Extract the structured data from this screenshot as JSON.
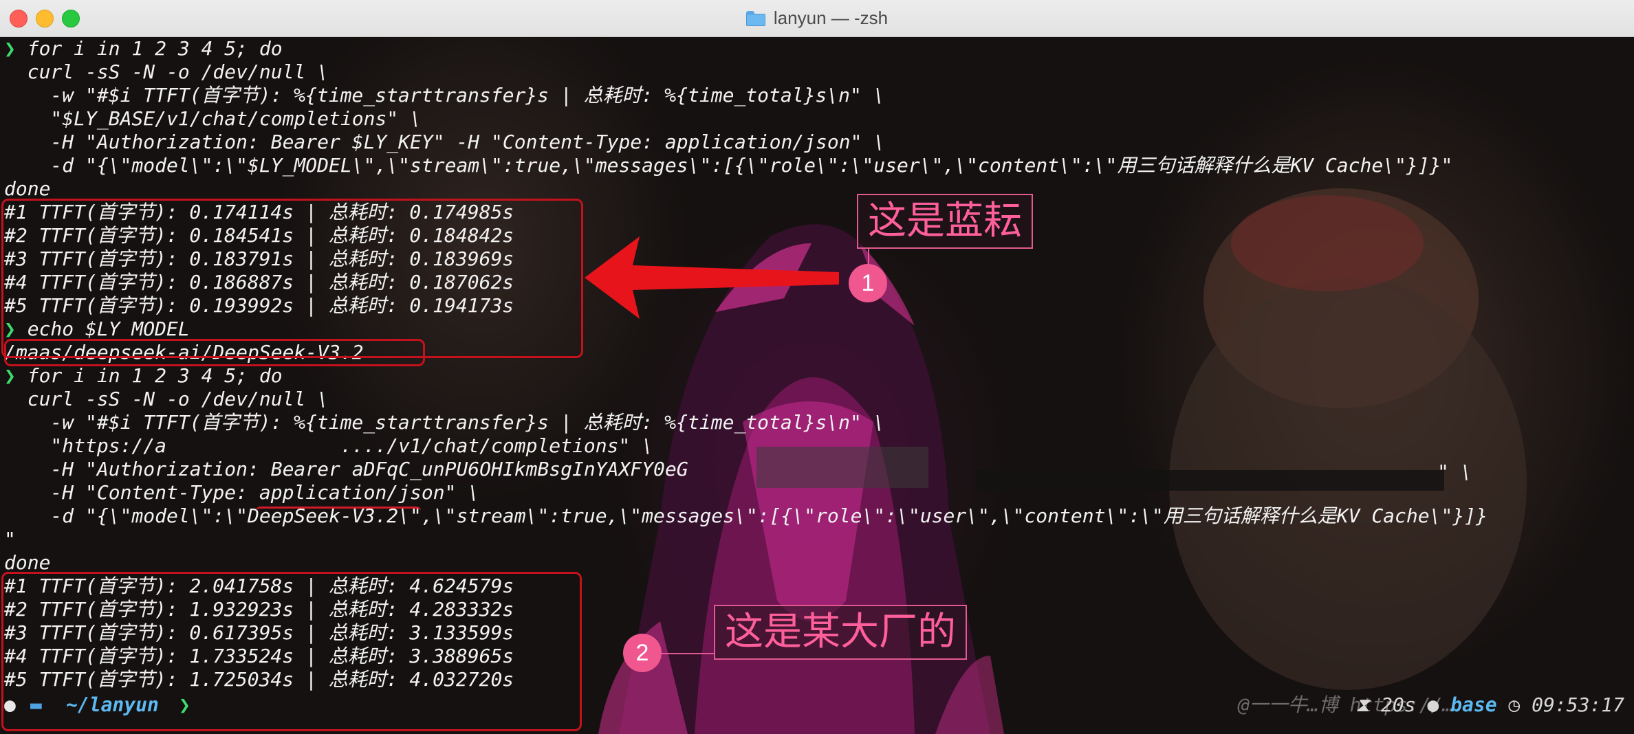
{
  "window": {
    "title": "lanyun — -zsh",
    "folder_icon": "folder-icon"
  },
  "terminal": {
    "lines": [
      {
        "prompt": true,
        "text": " for i in 1 2 3 4 5; do"
      },
      {
        "prompt": false,
        "text": "  curl -sS -N -o /dev/null \\"
      },
      {
        "prompt": false,
        "text": "    -w \"#$i TTFT(首字节): %{time_starttransfer}s | 总耗时: %{time_total}s\\n\" \\"
      },
      {
        "prompt": false,
        "text": "    \"$LY_BASE/v1/chat/completions\" \\"
      },
      {
        "prompt": false,
        "text": "    -H \"Authorization: Bearer $LY_KEY\" -H \"Content-Type: application/json\" \\"
      },
      {
        "prompt": false,
        "text": "    -d \"{\\\"model\\\":\\\"$LY_MODEL\\\",\\\"stream\\\":true,\\\"messages\\\":[{\\\"role\\\":\\\"user\\\",\\\"content\\\":\\\"用三句话解释什么是KV Cache\\\"}]}\""
      },
      {
        "prompt": false,
        "text": "done"
      },
      {
        "prompt": false,
        "text": "#1 TTFT(首字节): 0.174114s | 总耗时: 0.174985s"
      },
      {
        "prompt": false,
        "text": "#2 TTFT(首字节): 0.184541s | 总耗时: 0.184842s"
      },
      {
        "prompt": false,
        "text": "#3 TTFT(首字节): 0.183791s | 总耗时: 0.183969s"
      },
      {
        "prompt": false,
        "text": "#4 TTFT(首字节): 0.186887s | 总耗时: 0.187062s"
      },
      {
        "prompt": false,
        "text": "#5 TTFT(首字节): 0.193992s | 总耗时: 0.194173s"
      },
      {
        "prompt": true,
        "text": " echo $LY_MODEL"
      },
      {
        "prompt": false,
        "text": "/maas/deepseek-ai/DeepSeek-V3.2"
      },
      {
        "prompt": true,
        "text": " for i in 1 2 3 4 5; do"
      },
      {
        "prompt": false,
        "text": "  curl -sS -N -o /dev/null \\"
      },
      {
        "prompt": false,
        "text": "    -w \"#$i TTFT(首字节): %{time_starttransfer}s | 总耗时: %{time_total}s\\n\" \\"
      },
      {
        "prompt": false,
        "text": "    \"https://a               ..../v1/chat/completions\" \\"
      },
      {
        "prompt": false,
        "text": "    -H \"Authorization: Bearer aDFqC_unPU6OHIkmBsgInYAXFY0eG"
      },
      {
        "prompt": false,
        "text": "    -H \"Content-Type: application/json\" \\"
      },
      {
        "prompt": false,
        "text": "    -d \"{\\\"model\\\":\\\"DeepSeek-V3.2\\\",\\\"stream\\\":true,\\\"messages\\\":[{\\\"role\\\":\\\"user\\\",\\\"content\\\":\\\"用三句话解释什么是KV Cache\\\"}]}"
      },
      {
        "prompt": false,
        "text": "\""
      },
      {
        "prompt": false,
        "text": "done"
      },
      {
        "prompt": false,
        "text": "#1 TTFT(首字节): 2.041758s | 总耗时: 4.624579s"
      },
      {
        "prompt": false,
        "text": "#2 TTFT(首字节): 1.932923s | 总耗时: 4.283332s"
      },
      {
        "prompt": false,
        "text": "#3 TTFT(首字节): 0.617395s | 总耗时: 3.133599s"
      },
      {
        "prompt": false,
        "text": "#4 TTFT(首字节): 1.733524s | 总耗时: 3.388965s"
      },
      {
        "prompt": false,
        "text": "#5 TTFT(首字节): 1.725034s | 总耗时: 4.032720s"
      }
    ],
    "auth_tail": "\" \\",
    "prompt_symbol": "❯"
  },
  "annotations": {
    "label1": "这是蓝耘",
    "label2": "这是某大厂的",
    "badge1": "1",
    "badge2": "2",
    "colors": {
      "box": "#c4121c",
      "label": "#ff5f9a",
      "badge": "#f0578f",
      "arrow": "#e8141c"
    }
  },
  "statusbar": {
    "apple_icon": "apple-icon",
    "dir_icon": "folder-icon",
    "path": "~/lanyun",
    "chevron": "❯",
    "watermark": "@一一牛…博 https://…",
    "duration": "20s",
    "env": "base",
    "time": "09:53:17",
    "hourglass_icon": "hourglass-icon",
    "clock_icon": "clock-icon"
  }
}
